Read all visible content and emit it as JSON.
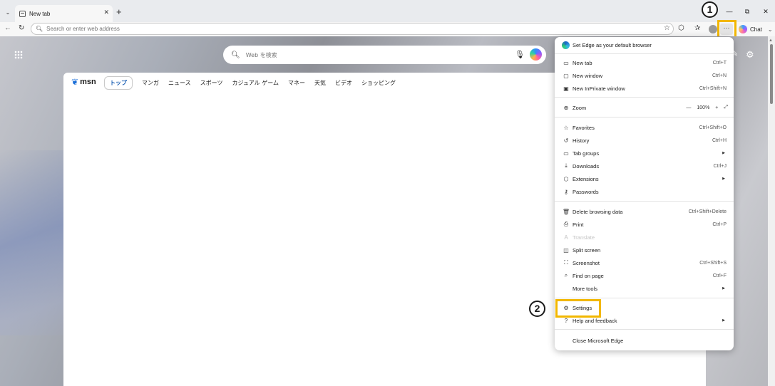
{
  "browser": {
    "tab": {
      "title": "New tab"
    },
    "address_bar": {
      "placeholder": "Search or enter web address"
    },
    "chat_label": "Chat"
  },
  "page": {
    "search_placeholder": "Web を検索",
    "msn_logo": "msn",
    "nav": [
      "トップ",
      "マンガ",
      "ニュース",
      "スポーツ",
      "カジュアル ゲーム",
      "マネー",
      "天気",
      "ビデオ",
      "ショッピング"
    ]
  },
  "menu": {
    "default_browser": "Set Edge as your default browser",
    "new_tab": {
      "label": "New tab",
      "shortcut": "Ctrl+T"
    },
    "new_window": {
      "label": "New window",
      "shortcut": "Ctrl+N"
    },
    "new_inprivate": {
      "label": "New InPrivate window",
      "shortcut": "Ctrl+Shift+N"
    },
    "zoom": {
      "label": "Zoom",
      "minus": "—",
      "value": "100%",
      "plus": "+",
      "fullscreen": "⤢"
    },
    "favorites": {
      "label": "Favorites",
      "shortcut": "Ctrl+Shift+O"
    },
    "history": {
      "label": "History",
      "shortcut": "Ctrl+H"
    },
    "tab_groups": {
      "label": "Tab groups"
    },
    "downloads": {
      "label": "Downloads",
      "shortcut": "Ctrl+J"
    },
    "extensions": {
      "label": "Extensions"
    },
    "passwords": {
      "label": "Passwords"
    },
    "delete_browsing": {
      "label": "Delete browsing data",
      "shortcut": "Ctrl+Shift+Delete"
    },
    "print": {
      "label": "Print",
      "shortcut": "Ctrl+P"
    },
    "translate": {
      "label": "Translate"
    },
    "split_screen": {
      "label": "Split screen"
    },
    "screenshot": {
      "label": "Screenshot",
      "shortcut": "Ctrl+Shift+S"
    },
    "find_on_page": {
      "label": "Find on page",
      "shortcut": "Ctrl+F"
    },
    "more_tools": {
      "label": "More tools"
    },
    "settings": {
      "label": "Settings"
    },
    "help": {
      "label": "Help and feedback"
    },
    "close_edge": {
      "label": "Close Microsoft Edge"
    }
  },
  "annotations": {
    "step1": "1",
    "step2": "2",
    "highlight_color": "#f2b700"
  },
  "icons": [
    "tab-list-chevron-icon",
    "new-tab-page-icon",
    "back-arrow-icon",
    "refresh-icon",
    "search-icon",
    "star-icon",
    "extension-icon",
    "favorites-icon",
    "profile-icon",
    "more-dots-icon",
    "copilot-icon",
    "apps-grid-icon",
    "mic-icon",
    "gear-icon",
    "pencil-icon",
    "msn-butterfly-icon",
    "edge-logo-icon"
  ]
}
